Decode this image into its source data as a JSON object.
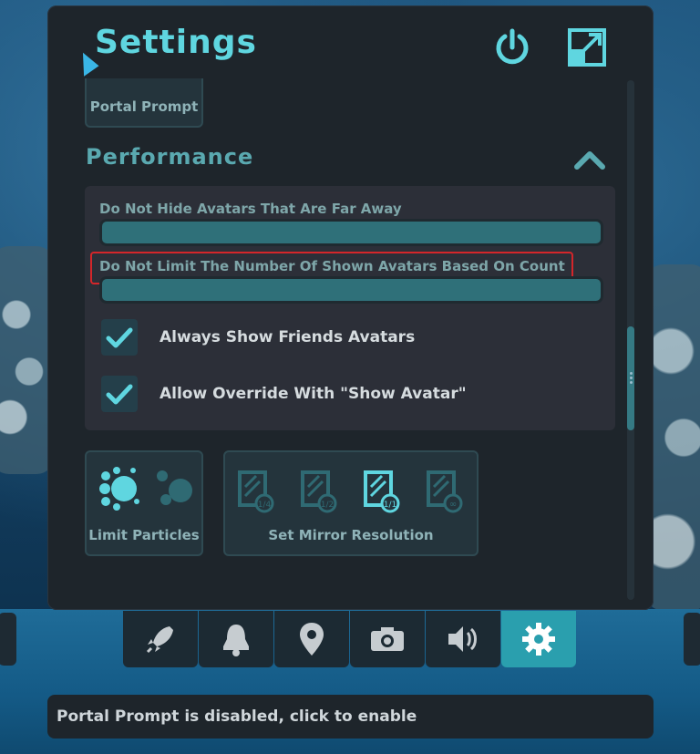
{
  "header": {
    "title": "Settings"
  },
  "portal_prompt": {
    "label": "Portal Prompt"
  },
  "performance": {
    "section_title": "Performance",
    "sliders": [
      {
        "label": "Do Not Hide Avatars That Are Far Away",
        "value": 1.0
      },
      {
        "label": "Do Not Limit The Number Of Shown Avatars Based On Count",
        "value": 1.0
      }
    ],
    "checkboxes": [
      {
        "label": "Always Show Friends Avatars",
        "checked": true
      },
      {
        "label": "Allow Override With \"Show Avatar\"",
        "checked": true
      }
    ]
  },
  "particles": {
    "label": "Limit Particles"
  },
  "mirror": {
    "label": "Set Mirror Resolution",
    "options": [
      "1/4",
      "1/2",
      "1/1",
      "∞"
    ],
    "selected": "1/1"
  },
  "nav": {
    "items": [
      {
        "icon": "rocket-icon"
      },
      {
        "icon": "bell-icon"
      },
      {
        "icon": "location-pin-icon"
      },
      {
        "icon": "camera-icon"
      },
      {
        "icon": "speaker-icon"
      },
      {
        "icon": "gear-icon",
        "active": true
      }
    ]
  },
  "status": {
    "text": "Portal Prompt is disabled, click to enable"
  },
  "colors": {
    "accent": "#5fd6e0",
    "slider_fill": "#2f7079",
    "active_tab": "#2a9fae",
    "highlight": "#d4262a"
  }
}
